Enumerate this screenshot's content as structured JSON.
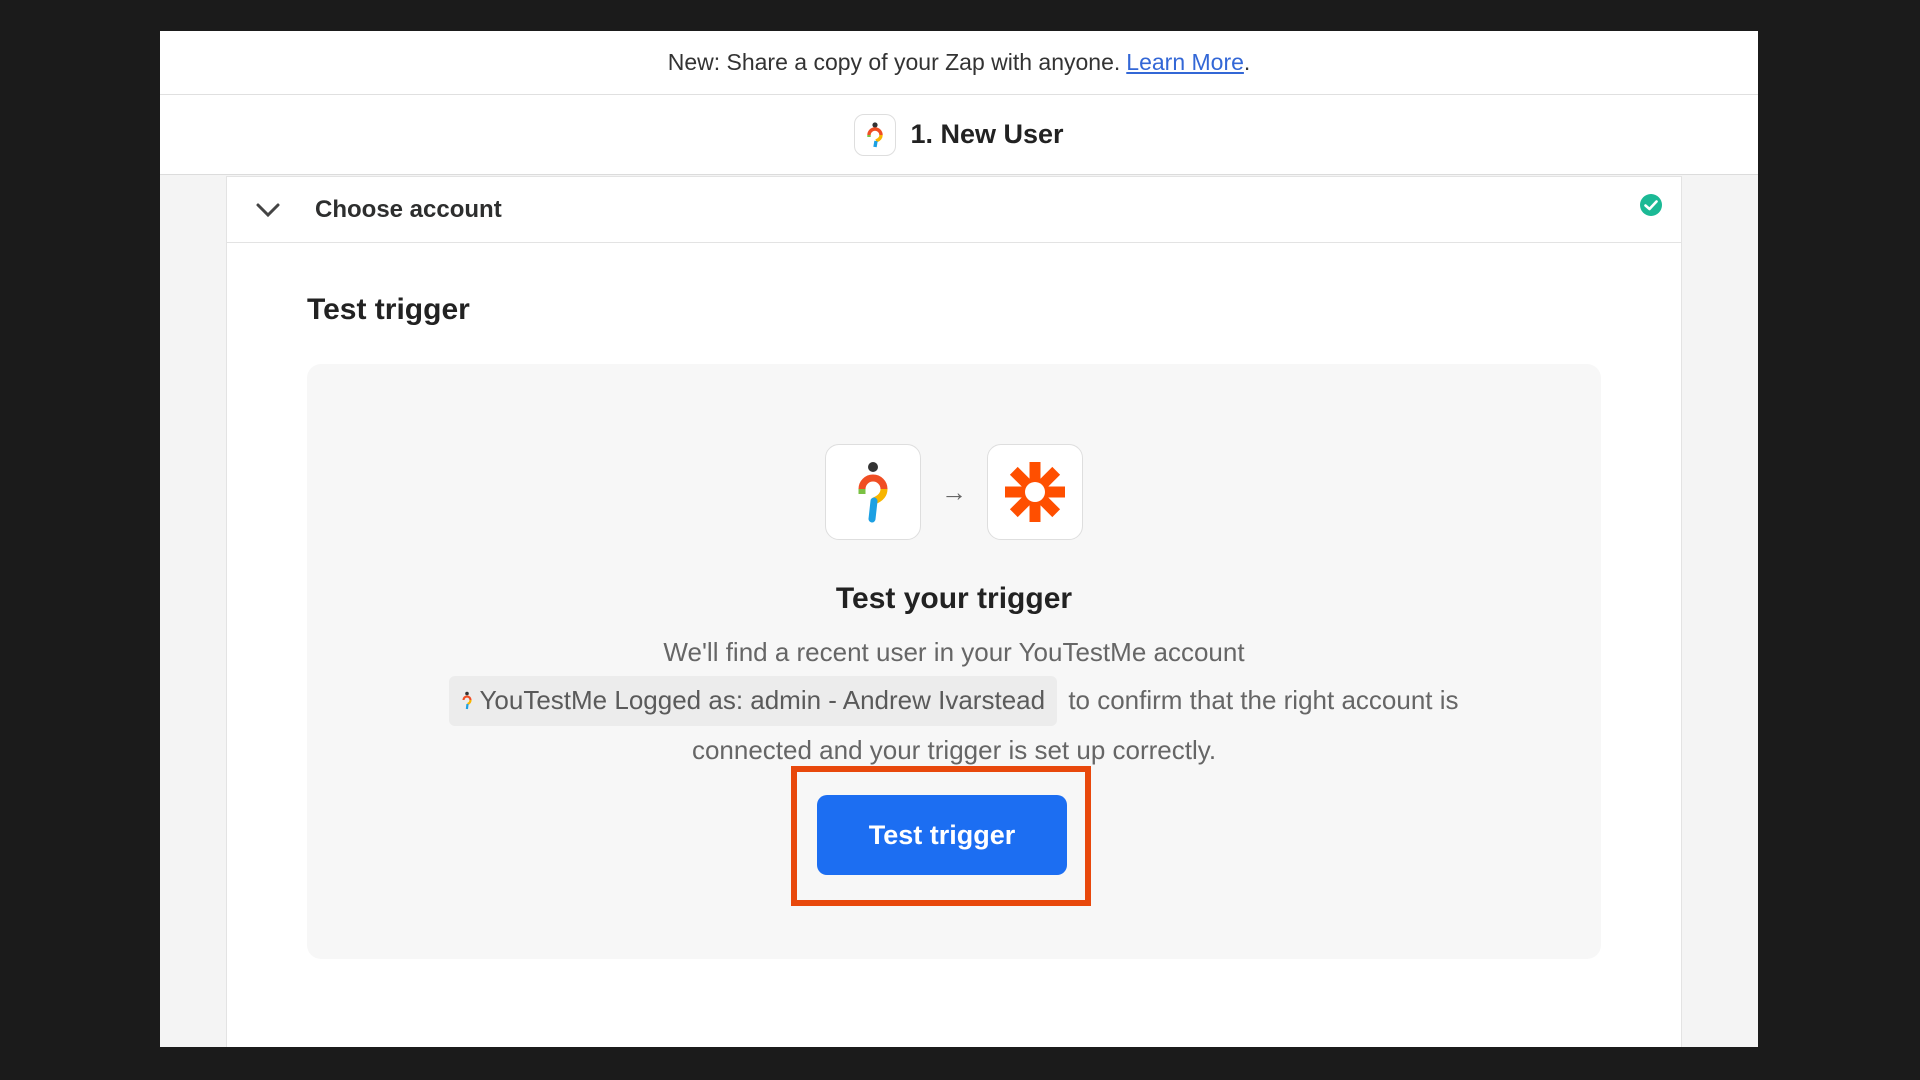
{
  "banner": {
    "text": "New: Share a copy of your Zap with anyone.",
    "link": "Learn More",
    "suffix": "."
  },
  "step": {
    "title": "1. New User",
    "icon": "youtestme-logo-icon"
  },
  "accordion": {
    "label": "Choose account",
    "status": "complete",
    "status_color": "#1bb995"
  },
  "section": {
    "title": "Test trigger"
  },
  "test_panel": {
    "source_app_icon": "youtestme-logo-icon",
    "target_app_icon": "zapier-asterisk-icon",
    "title": "Test your trigger",
    "line1": "We'll find a recent user in your YouTestMe account",
    "account_chip": "YouTestMe Logged as: admin - Andrew Ivarstead",
    "line2": "to confirm that the right account is",
    "line3": "connected and your trigger is set up correctly.",
    "button": "Test trigger"
  },
  "colors": {
    "button": "#1c6ef2",
    "highlight": "#e8480c",
    "zapier_orange": "#ff4f00",
    "check": "#1bb995"
  }
}
